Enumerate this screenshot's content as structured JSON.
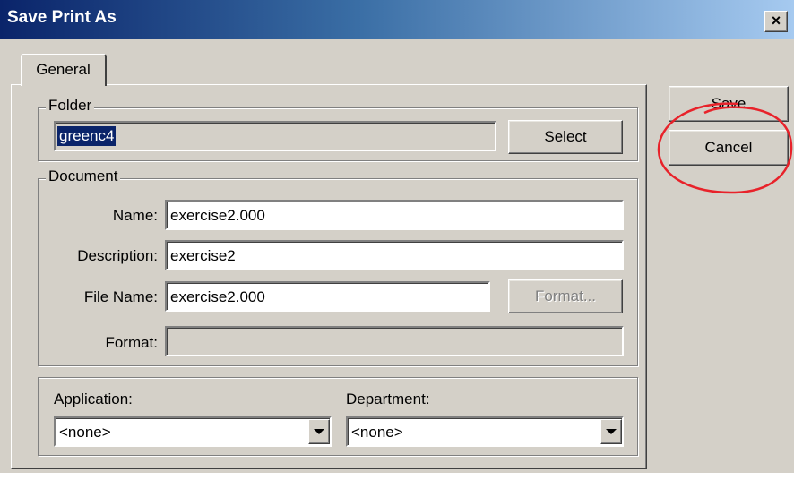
{
  "window": {
    "title": "Save Print As",
    "close_symbol": "×"
  },
  "tabs": [
    {
      "label": "General"
    }
  ],
  "folder": {
    "label": "Folder",
    "value": "greenc4",
    "select_label": "Select"
  },
  "document": {
    "label": "Document",
    "name_label": "Name:",
    "name_value": "exercise2.000",
    "description_label": "Description:",
    "description_value": "exercise2",
    "filename_label": "File Name:",
    "filename_value": "exercise2.000",
    "format_button_label": "Format...",
    "format_label": "Format:",
    "format_value": ""
  },
  "application": {
    "label": "Application:",
    "selected": "<none>"
  },
  "department": {
    "label": "Department:",
    "selected": "<none>"
  },
  "actions": {
    "save_label": "Save",
    "cancel_label": "Cancel"
  },
  "annotation": {
    "color": "#e8222a"
  },
  "colors": {
    "titlebar_start": "#0a246a",
    "titlebar_end": "#a6caf0",
    "face": "#d4d0c8",
    "selection": "#0a246a"
  }
}
